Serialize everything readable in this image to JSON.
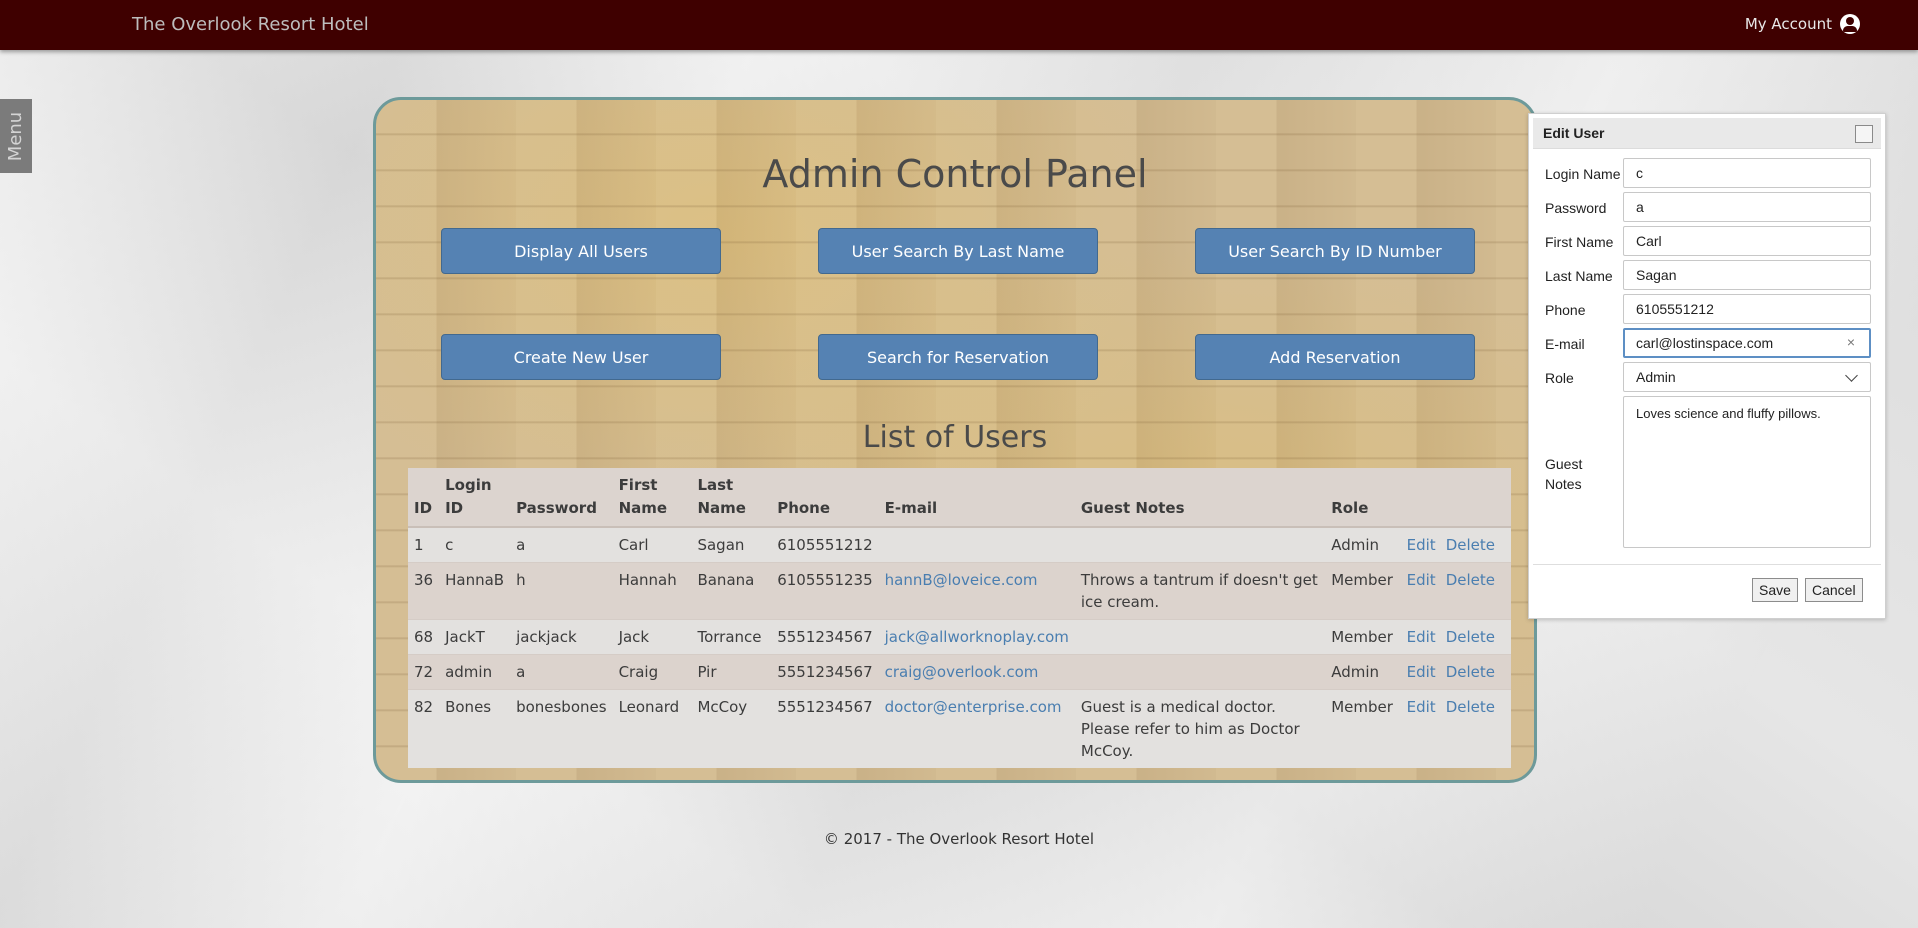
{
  "header": {
    "brand": "The Overlook Resort Hotel",
    "account_label": "My Account",
    "account_icon": "account-circle-icon",
    "bg_color": "#3f0000"
  },
  "sidebar": {
    "menu_label": "Menu"
  },
  "panel": {
    "title": "Admin Control Panel",
    "buttons": [
      "Display All Users",
      "User Search By Last Name",
      "User Search By ID Number",
      "Create New User",
      "Search for Reservation",
      "Add Reservation"
    ],
    "list_title": "List of Users"
  },
  "table": {
    "columns": [
      "ID",
      "Login ID",
      "Password",
      "First Name",
      "Last Name",
      "Phone",
      "E-mail",
      "Guest Notes",
      "Role"
    ],
    "edit_label": "Edit",
    "delete_label": "Delete",
    "rows": [
      {
        "id": "1",
        "login": "c",
        "password": "a",
        "first": "Carl",
        "last": "Sagan",
        "phone": "6105551212",
        "email": "",
        "notes": "",
        "role": "Admin"
      },
      {
        "id": "36",
        "login": "HannaB",
        "password": "h",
        "first": "Hannah",
        "last": "Banana",
        "phone": "6105551235",
        "email": "hannB@loveice.com",
        "notes": "Throws a tantrum if doesn't get ice cream.",
        "role": "Member"
      },
      {
        "id": "68",
        "login": "JackT",
        "password": "jackjack",
        "first": "Jack",
        "last": "Torrance",
        "phone": "5551234567",
        "email": "jack@allworknoplay.com",
        "notes": "",
        "role": "Member"
      },
      {
        "id": "72",
        "login": "admin",
        "password": "a",
        "first": "Craig",
        "last": "Pir",
        "phone": "5551234567",
        "email": "craig@overlook.com",
        "notes": "",
        "role": "Admin"
      },
      {
        "id": "82",
        "login": "Bones",
        "password": "bonesbones",
        "first": "Leonard",
        "last": "McCoy",
        "phone": "5551234567",
        "email": "doctor@enterprise.com",
        "notes": "Guest is a medical doctor. Please refer to him as Doctor McCoy.",
        "role": "Member"
      }
    ]
  },
  "footer": {
    "text": "© 2017 - The Overlook Resort Hotel"
  },
  "dialog": {
    "title": "Edit User",
    "fields": {
      "login_label": "Login Name",
      "login_value": "c",
      "password_label": "Password",
      "password_value": "a",
      "first_label": "First Name",
      "first_value": "Carl",
      "last_label": "Last Name",
      "last_value": "Sagan",
      "phone_label": "Phone",
      "phone_value": "6105551212",
      "email_label": "E-mail",
      "email_value": "carl@lostinspace.com",
      "role_label": "Role",
      "role_value": "Admin",
      "notes_label": "Guest Notes",
      "notes_value": "Loves science and fluffy pillows."
    },
    "save_label": "Save",
    "cancel_label": "Cancel"
  }
}
